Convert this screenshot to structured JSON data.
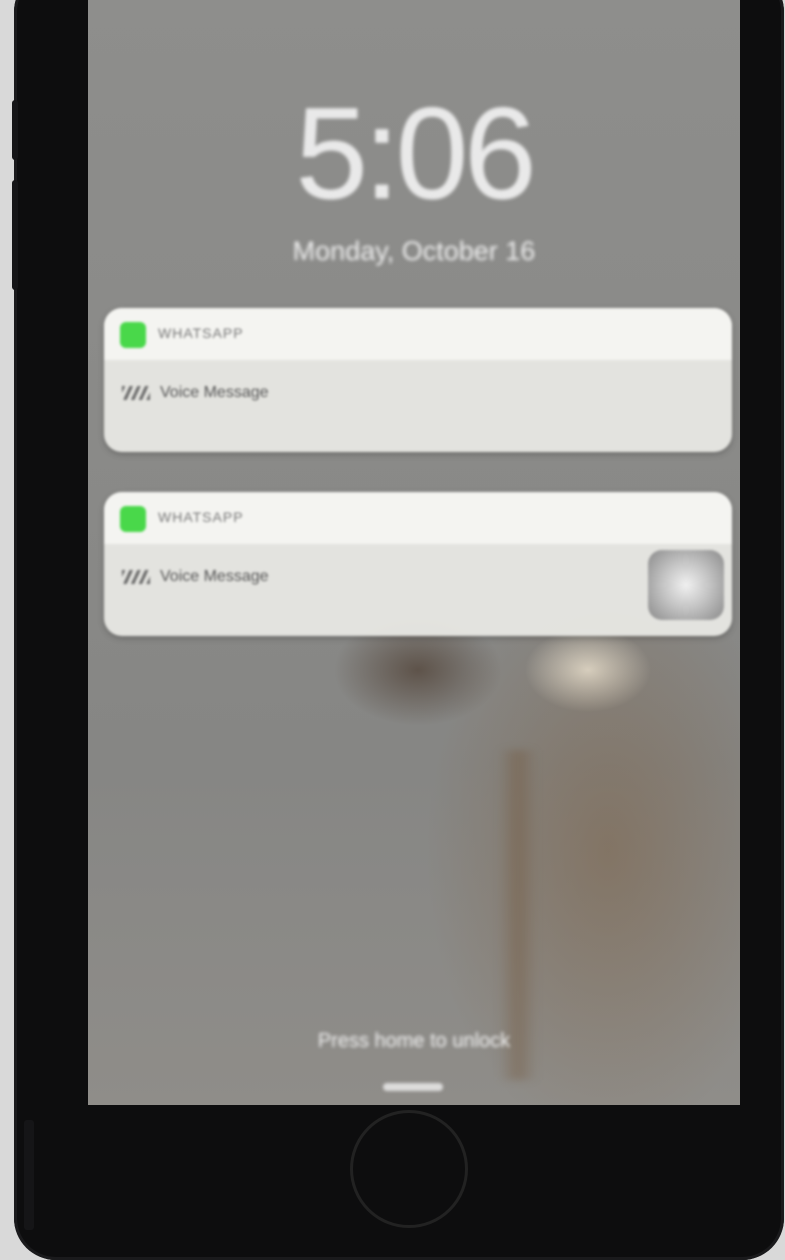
{
  "status_bar": {
    "carrier": "•••••  ",
    "battery_icon": "battery-icon"
  },
  "lock_screen": {
    "time": "5:06",
    "date": "Monday, October 16",
    "unlock_hint": "Press home to unlock"
  },
  "notifications": [
    {
      "app_name": "WHATSAPP",
      "time_ago": "",
      "sender": "",
      "message": "Voice Message",
      "hint": "",
      "app_icon_color": "#49d84a"
    },
    {
      "app_name": "WHATSAPP",
      "time_ago": "",
      "sender": "",
      "message": "Voice Message",
      "app_icon_color": "#49d84a"
    }
  ]
}
